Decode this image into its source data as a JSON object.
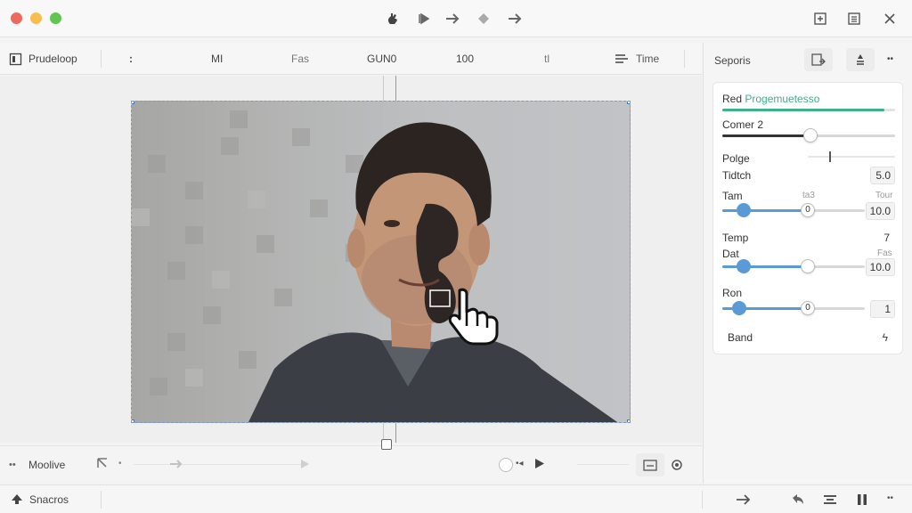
{
  "window": {
    "controls": {
      "close_color": "#ed6a5e",
      "minimize_color": "#f5bf4f",
      "zoom_color": "#61c554"
    },
    "toolbar_icons": [
      "hand-icon",
      "play-step-icon",
      "arrow-right-icon",
      "diamond-icon",
      "arrow-forward-icon"
    ],
    "right_icons": [
      "add-square-icon",
      "list-icon",
      "close-icon"
    ]
  },
  "toolbar": {
    "doc_name": "Prudeloop",
    "more": ":",
    "items": [
      "MI",
      "Fas",
      "GUN0",
      "100",
      "tl"
    ],
    "time_label": "Time"
  },
  "bottom_bar": {
    "mode_label": "Moolive"
  },
  "status_bar": {
    "label": "Snacros"
  },
  "right_panel": {
    "title": "Seporis",
    "card": {
      "progress_label_prefix": "Red",
      "progress_label_accent": "Progemuetesso",
      "progress_value": 0.94,
      "accent_color": "#3bb386",
      "rows": {
        "comer": {
          "label": "Comer 2",
          "value": 0.51
        },
        "polge": {
          "label": "Polge",
          "value": 0.25
        },
        "tidtch": {
          "label": "Tidtch",
          "value": "5.0"
        },
        "tam": {
          "label": "Tam",
          "hint_mid": "ta3",
          "hint_right": "Tour",
          "value": 0.15,
          "thumb_text": "0",
          "box": "10.0"
        },
        "temp": {
          "label": "Temp",
          "value": "7"
        },
        "dat": {
          "label": "Dat",
          "hint_right": "Fas",
          "value": 0.15,
          "box": "10.0"
        },
        "ron": {
          "label": "Ron",
          "value": 0.12,
          "thumb_text": "0",
          "box": "1"
        },
        "band": {
          "label": "Band"
        }
      }
    }
  }
}
